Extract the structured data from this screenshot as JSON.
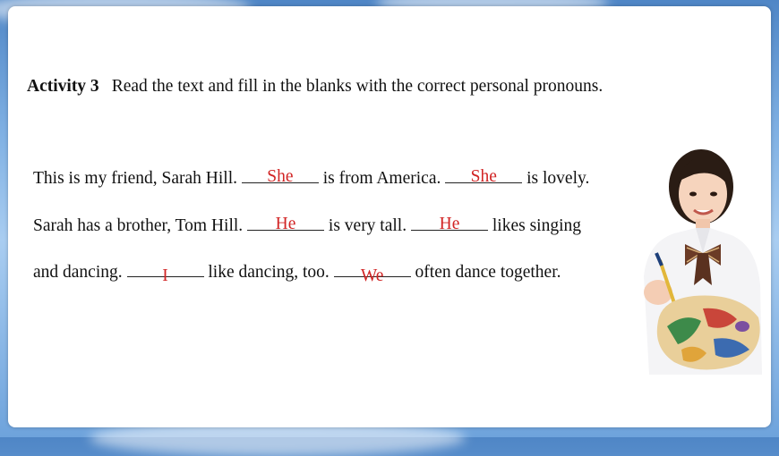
{
  "activity": {
    "label": "Activity 3",
    "instruction": "Read the text and fill in the blanks with the correct personal pronouns."
  },
  "passage": {
    "line1": {
      "seg1": "This is my friend, Sarah Hill. ",
      "blank1": "She",
      "seg2": " is from America. ",
      "blank2": "She",
      "seg3": " is lovely."
    },
    "line2": {
      "seg1": "Sarah has a brother, Tom Hill. ",
      "blank1": "He",
      "seg2": " is very tall. ",
      "blank2": "He",
      "seg3": " likes singing"
    },
    "line3": {
      "seg1": "and dancing. ",
      "blank1": "I",
      "seg2": " like dancing, too. ",
      "blank2": "We",
      "seg3": " often dance together."
    }
  },
  "illustration": {
    "icon": "student-painter-icon"
  },
  "colors": {
    "answer": "#d12424",
    "text": "#111111",
    "background": "#7fb0e3"
  }
}
